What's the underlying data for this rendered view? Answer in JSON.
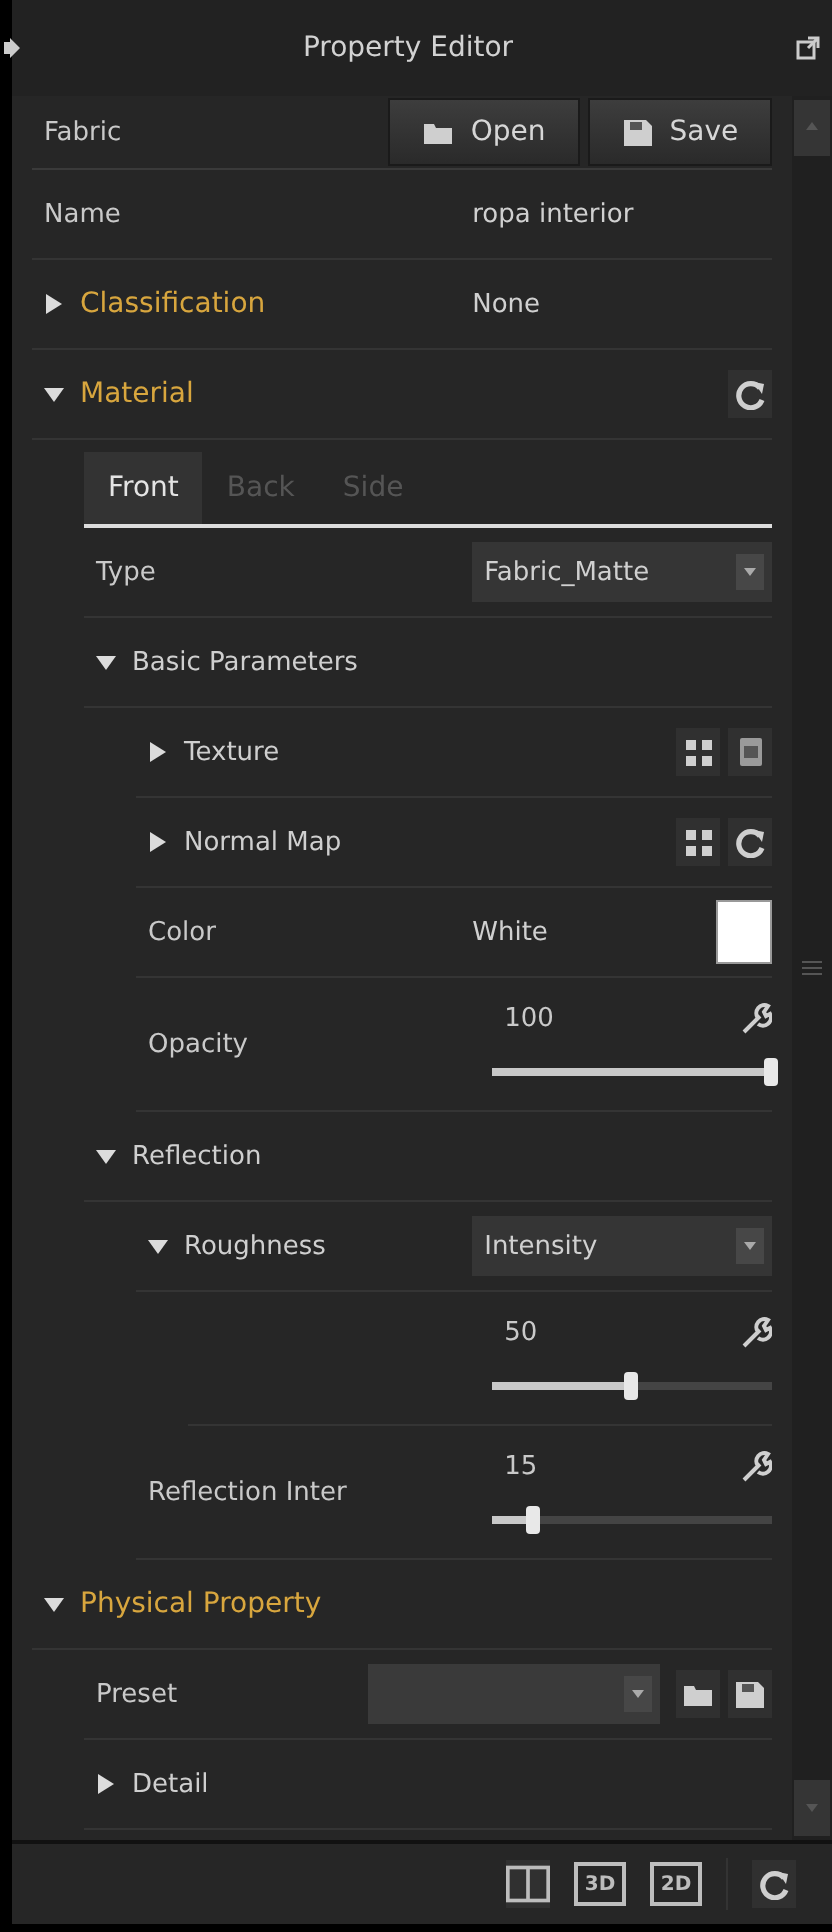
{
  "title": "Property Editor",
  "rows": [
    {
      "kind": "buttons",
      "label": "Fabric",
      "buttons": [
        {
          "label": "Open",
          "kind": "folder"
        },
        {
          "label": "Save",
          "kind": "disk"
        }
      ]
    },
    {
      "kind": "text",
      "label": "Name",
      "value": "ropa interior"
    },
    {
      "kind": "section",
      "label": "Classification",
      "expanded": false,
      "value": "None"
    },
    {
      "kind": "section",
      "label": "Material",
      "expanded": true,
      "tools": [
        {
          "kind": "reset"
        }
      ],
      "children": [
        {
          "kind": "tabs",
          "tabs": [
            {
              "label": "Front",
              "selected": true
            },
            {
              "label": "Back",
              "selected": false
            },
            {
              "label": "Side",
              "selected": false
            }
          ]
        },
        {
          "kind": "dropdown",
          "label": "Type",
          "value": "Fabric_Matte"
        },
        {
          "kind": "group",
          "label": "Basic Parameters",
          "expanded": true,
          "children": [
            {
              "kind": "group",
              "label": "Texture",
              "expanded": false,
              "tools": [
                {
                  "kind": "grid"
                },
                {
                  "kind": "file"
                }
              ]
            },
            {
              "kind": "group",
              "label": "Normal Map",
              "expanded": false,
              "tools": [
                {
                  "kind": "grid"
                },
                {
                  "kind": "reset"
                }
              ]
            },
            {
              "kind": "color",
              "label": "Color",
              "value": "White",
              "color": "#ffffff"
            },
            {
              "kind": "slider",
              "label": "Opacity",
              "reading": "100",
              "level": 1.0
            }
          ]
        },
        {
          "kind": "group",
          "label": "Reflection",
          "expanded": true,
          "children": [
            {
              "kind": "group",
              "label": "Roughness",
              "expanded": true,
              "value": "Intensity",
              "children": [
                {
                  "kind": "slider",
                  "reading": "50",
                  "level": 0.5
                }
              ]
            },
            {
              "kind": "slider",
              "label": "Reflection Inter",
              "reading": "15",
              "level": 0.15
            }
          ]
        }
      ]
    },
    {
      "kind": "section",
      "label": "Physical Property",
      "expanded": true,
      "children": [
        {
          "kind": "preset",
          "label": "Preset"
        },
        {
          "kind": "group",
          "label": "Detail",
          "expanded": false
        }
      ]
    }
  ],
  "toolbar": [
    {
      "kind": "split"
    },
    {
      "kind": "text",
      "label": "3D"
    },
    {
      "kind": "text",
      "label": "2D"
    },
    {
      "kind": "reset"
    }
  ]
}
